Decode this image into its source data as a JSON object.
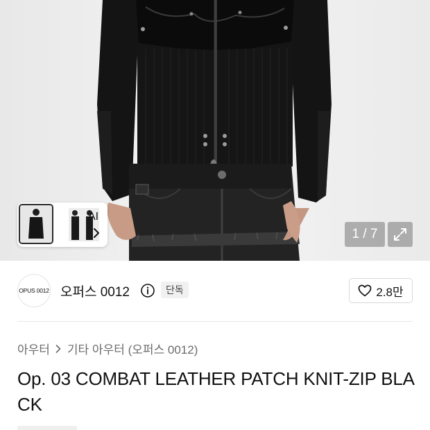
{
  "gallery": {
    "thumbnail_label": "AI",
    "counter": "1 / 7"
  },
  "brand": {
    "logo_text": "OPUS 0012",
    "name": "오퍼스 0012",
    "badge": "단독",
    "likes": "2.8만"
  },
  "breadcrumb": {
    "category": "아우터",
    "subcategory": "기타 아우터 (오퍼스 0012)"
  },
  "product": {
    "title": "Op. 03 COMBAT LEATHER PATCH KNIT-ZIP BLACK"
  },
  "icons": [
    "chevron-right-icon",
    "expand-icon",
    "info-icon",
    "heart-icon"
  ]
}
